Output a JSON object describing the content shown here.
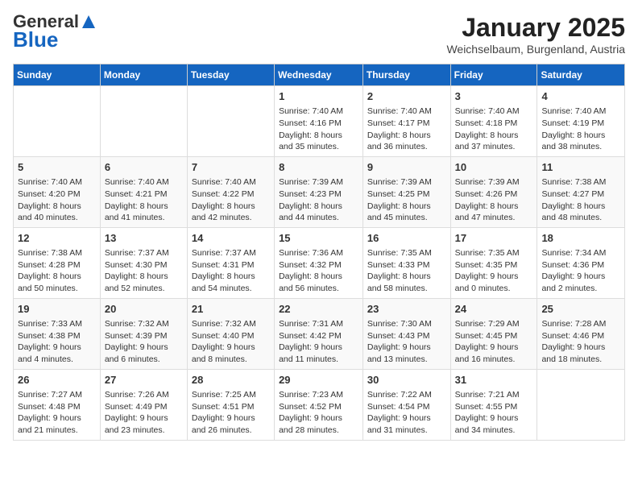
{
  "header": {
    "logo_general": "General",
    "logo_blue": "Blue",
    "month": "January 2025",
    "location": "Weichselbaum, Burgenland, Austria"
  },
  "weekdays": [
    "Sunday",
    "Monday",
    "Tuesday",
    "Wednesday",
    "Thursday",
    "Friday",
    "Saturday"
  ],
  "weeks": [
    [
      {
        "day": "",
        "info": ""
      },
      {
        "day": "",
        "info": ""
      },
      {
        "day": "",
        "info": ""
      },
      {
        "day": "1",
        "info": "Sunrise: 7:40 AM\nSunset: 4:16 PM\nDaylight: 8 hours and 35 minutes."
      },
      {
        "day": "2",
        "info": "Sunrise: 7:40 AM\nSunset: 4:17 PM\nDaylight: 8 hours and 36 minutes."
      },
      {
        "day": "3",
        "info": "Sunrise: 7:40 AM\nSunset: 4:18 PM\nDaylight: 8 hours and 37 minutes."
      },
      {
        "day": "4",
        "info": "Sunrise: 7:40 AM\nSunset: 4:19 PM\nDaylight: 8 hours and 38 minutes."
      }
    ],
    [
      {
        "day": "5",
        "info": "Sunrise: 7:40 AM\nSunset: 4:20 PM\nDaylight: 8 hours and 40 minutes."
      },
      {
        "day": "6",
        "info": "Sunrise: 7:40 AM\nSunset: 4:21 PM\nDaylight: 8 hours and 41 minutes."
      },
      {
        "day": "7",
        "info": "Sunrise: 7:40 AM\nSunset: 4:22 PM\nDaylight: 8 hours and 42 minutes."
      },
      {
        "day": "8",
        "info": "Sunrise: 7:39 AM\nSunset: 4:23 PM\nDaylight: 8 hours and 44 minutes."
      },
      {
        "day": "9",
        "info": "Sunrise: 7:39 AM\nSunset: 4:25 PM\nDaylight: 8 hours and 45 minutes."
      },
      {
        "day": "10",
        "info": "Sunrise: 7:39 AM\nSunset: 4:26 PM\nDaylight: 8 hours and 47 minutes."
      },
      {
        "day": "11",
        "info": "Sunrise: 7:38 AM\nSunset: 4:27 PM\nDaylight: 8 hours and 48 minutes."
      }
    ],
    [
      {
        "day": "12",
        "info": "Sunrise: 7:38 AM\nSunset: 4:28 PM\nDaylight: 8 hours and 50 minutes."
      },
      {
        "day": "13",
        "info": "Sunrise: 7:37 AM\nSunset: 4:30 PM\nDaylight: 8 hours and 52 minutes."
      },
      {
        "day": "14",
        "info": "Sunrise: 7:37 AM\nSunset: 4:31 PM\nDaylight: 8 hours and 54 minutes."
      },
      {
        "day": "15",
        "info": "Sunrise: 7:36 AM\nSunset: 4:32 PM\nDaylight: 8 hours and 56 minutes."
      },
      {
        "day": "16",
        "info": "Sunrise: 7:35 AM\nSunset: 4:33 PM\nDaylight: 8 hours and 58 minutes."
      },
      {
        "day": "17",
        "info": "Sunrise: 7:35 AM\nSunset: 4:35 PM\nDaylight: 9 hours and 0 minutes."
      },
      {
        "day": "18",
        "info": "Sunrise: 7:34 AM\nSunset: 4:36 PM\nDaylight: 9 hours and 2 minutes."
      }
    ],
    [
      {
        "day": "19",
        "info": "Sunrise: 7:33 AM\nSunset: 4:38 PM\nDaylight: 9 hours and 4 minutes."
      },
      {
        "day": "20",
        "info": "Sunrise: 7:32 AM\nSunset: 4:39 PM\nDaylight: 9 hours and 6 minutes."
      },
      {
        "day": "21",
        "info": "Sunrise: 7:32 AM\nSunset: 4:40 PM\nDaylight: 9 hours and 8 minutes."
      },
      {
        "day": "22",
        "info": "Sunrise: 7:31 AM\nSunset: 4:42 PM\nDaylight: 9 hours and 11 minutes."
      },
      {
        "day": "23",
        "info": "Sunrise: 7:30 AM\nSunset: 4:43 PM\nDaylight: 9 hours and 13 minutes."
      },
      {
        "day": "24",
        "info": "Sunrise: 7:29 AM\nSunset: 4:45 PM\nDaylight: 9 hours and 16 minutes."
      },
      {
        "day": "25",
        "info": "Sunrise: 7:28 AM\nSunset: 4:46 PM\nDaylight: 9 hours and 18 minutes."
      }
    ],
    [
      {
        "day": "26",
        "info": "Sunrise: 7:27 AM\nSunset: 4:48 PM\nDaylight: 9 hours and 21 minutes."
      },
      {
        "day": "27",
        "info": "Sunrise: 7:26 AM\nSunset: 4:49 PM\nDaylight: 9 hours and 23 minutes."
      },
      {
        "day": "28",
        "info": "Sunrise: 7:25 AM\nSunset: 4:51 PM\nDaylight: 9 hours and 26 minutes."
      },
      {
        "day": "29",
        "info": "Sunrise: 7:23 AM\nSunset: 4:52 PM\nDaylight: 9 hours and 28 minutes."
      },
      {
        "day": "30",
        "info": "Sunrise: 7:22 AM\nSunset: 4:54 PM\nDaylight: 9 hours and 31 minutes."
      },
      {
        "day": "31",
        "info": "Sunrise: 7:21 AM\nSunset: 4:55 PM\nDaylight: 9 hours and 34 minutes."
      },
      {
        "day": "",
        "info": ""
      }
    ]
  ]
}
